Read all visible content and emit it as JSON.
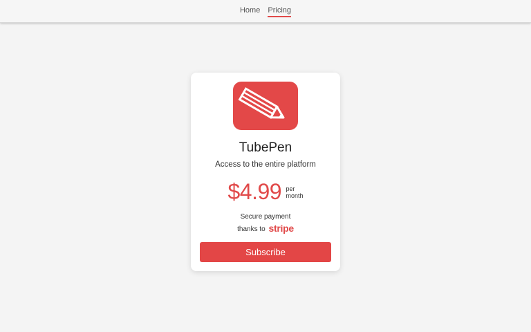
{
  "nav": {
    "items": [
      {
        "label": "Home",
        "active": false
      },
      {
        "label": "Pricing",
        "active": true
      }
    ]
  },
  "product": {
    "logo_icon": "pencil-logo-icon",
    "name": "TubePen",
    "description": "Access to the entire platform",
    "price": "$4.99",
    "period_line1": "per",
    "period_line2": "month",
    "secure_line1": "Secure payment",
    "secure_line2": "thanks to",
    "payment_brand": "stripe",
    "subscribe_label": "Subscribe"
  },
  "colors": {
    "accent": "#e14a4a",
    "button": "#e34646",
    "background": "#f4f4f4",
    "card": "#ffffff"
  }
}
